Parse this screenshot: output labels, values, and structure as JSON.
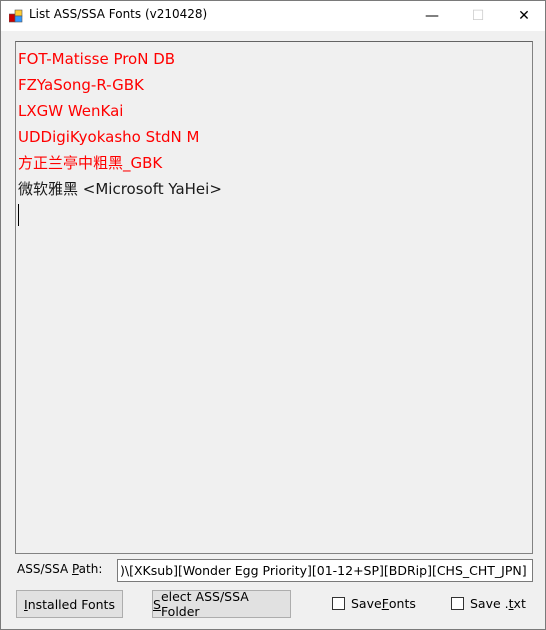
{
  "window": {
    "title": "List ASS/SSA Fonts (v210428)",
    "minimize": "—",
    "maximize": "☐",
    "close": "✕"
  },
  "font_list": [
    {
      "text": "FOT-Matisse ProN DB",
      "color": "#ff0000"
    },
    {
      "text": "FZYaSong-R-GBK",
      "color": "#ff0000"
    },
    {
      "text": "LXGW WenKai",
      "color": "#ff0000"
    },
    {
      "text": "UDDigiKyokasho StdN M",
      "color": "#ff0000"
    },
    {
      "text": "方正兰亭中粗黑_GBK",
      "color": "#ff0000"
    },
    {
      "text": "微软雅黑 <Microsoft YaHei>",
      "color": "#1a1a1a"
    }
  ],
  "path": {
    "label_pre": "ASS/SSA ",
    "label_u": "P",
    "label_post": "ath:",
    "value": ")\\[XKsub][Wonder Egg Priority][01-12+SP][BDRip][CHS_CHT_JPN]"
  },
  "buttons": {
    "installed": {
      "u": "I",
      "rest": "nstalled Fonts"
    },
    "select": {
      "u": "S",
      "rest": "elect ASS/SSA Folder"
    }
  },
  "checkboxes": {
    "save_fonts": {
      "pre": "Save ",
      "u": "F",
      "rest": "onts",
      "checked": false
    },
    "save_txt": {
      "pre": "Save .",
      "u": "t",
      "rest": "xt",
      "checked": false
    }
  }
}
